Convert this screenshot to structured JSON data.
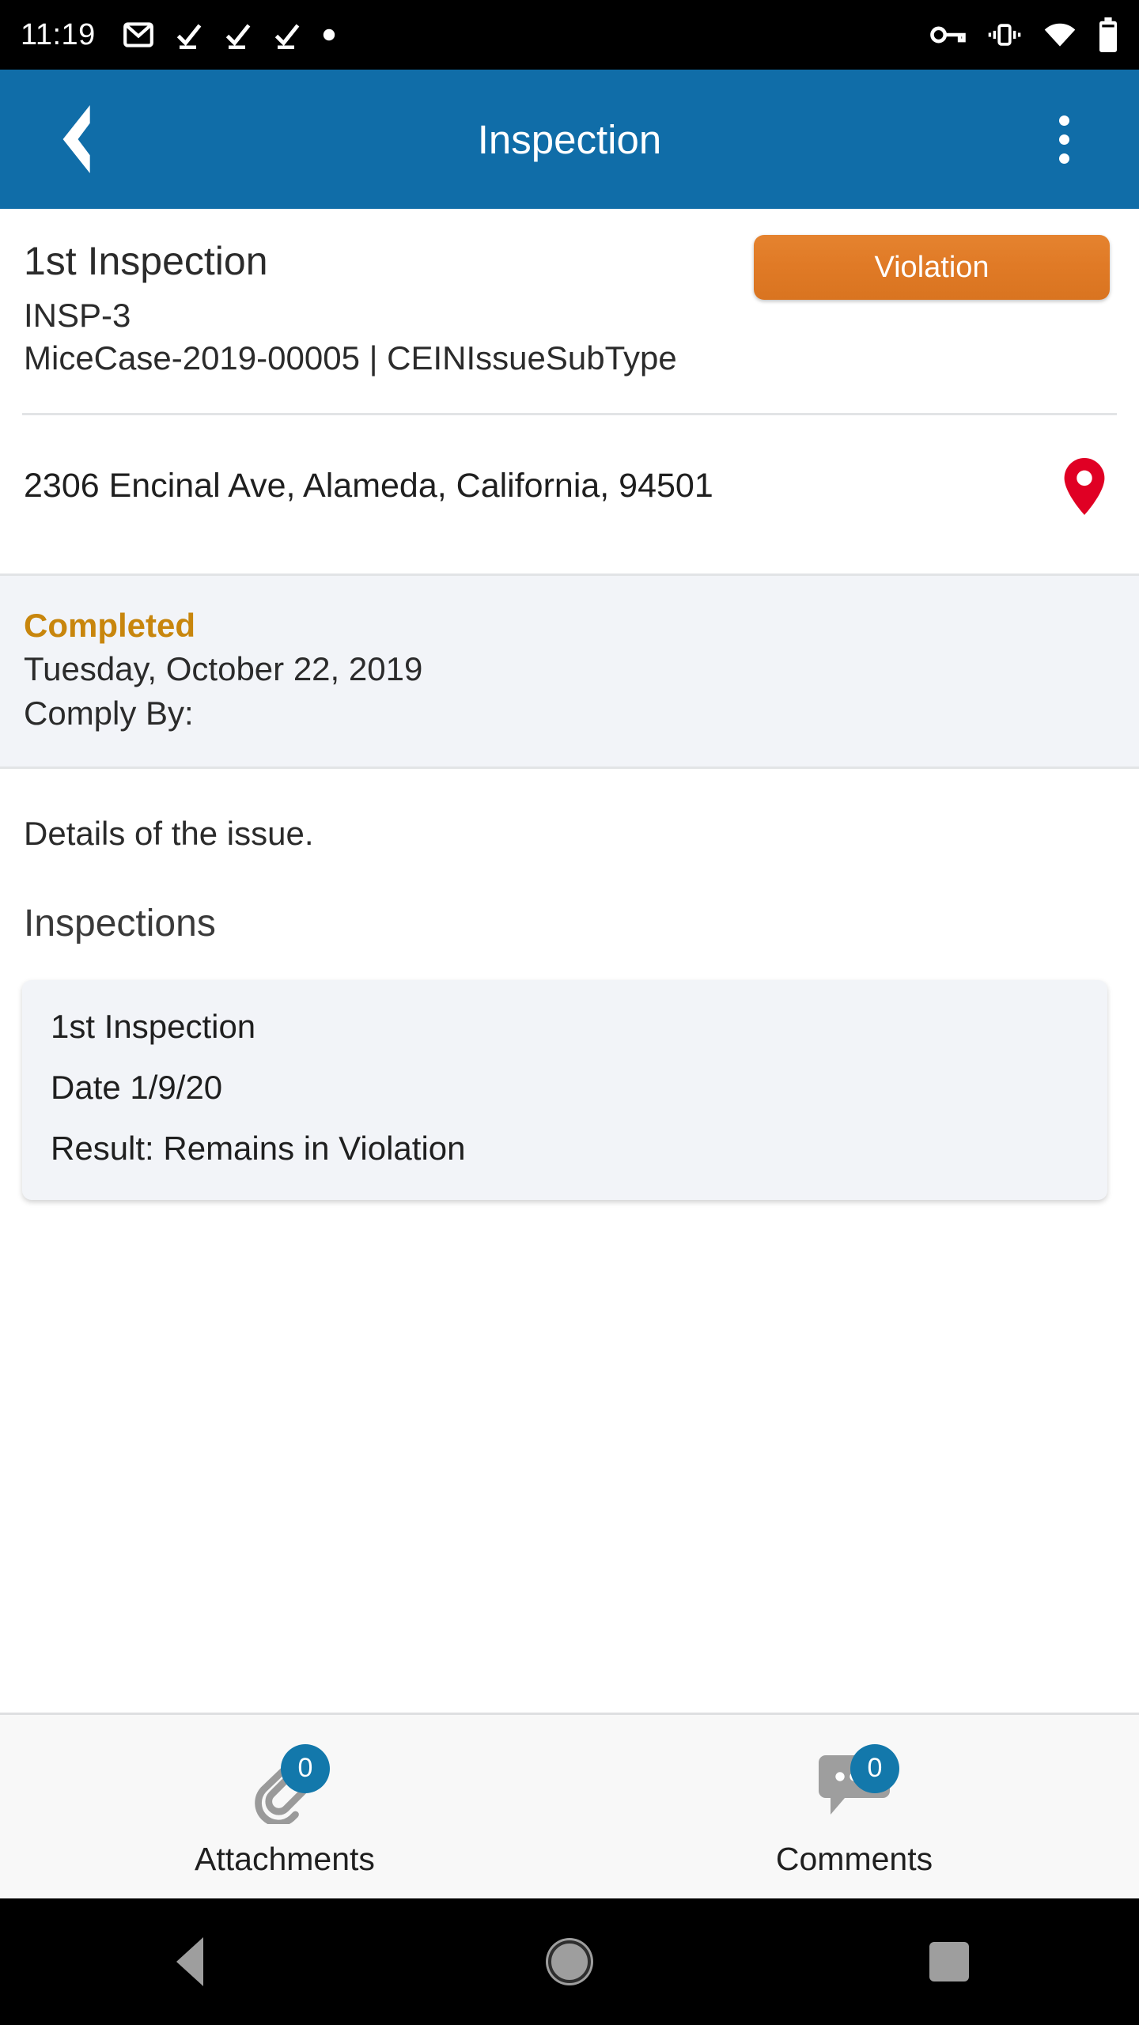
{
  "status_bar": {
    "time": "11:19",
    "left_icons": [
      "gmail-icon",
      "check-icon",
      "check-icon",
      "check-icon",
      "dot-icon"
    ],
    "right_icons": [
      "vpn-key-icon",
      "vibrate-icon",
      "wifi-icon",
      "battery-icon"
    ]
  },
  "app_bar": {
    "back_label": "back-chevron",
    "title": "Inspection",
    "overflow_label": "more-options"
  },
  "record": {
    "title": "1st Inspection",
    "code": "INSP-3",
    "case_line": "MiceCase-2019-00005 | CEINIssueSubType",
    "badge": "Violation",
    "badge_color": "#e07a26",
    "address": "2306 Encinal Ave, Alameda, California, 94501",
    "map_pin_color": "#e00024"
  },
  "status_panel": {
    "state": "Completed",
    "state_color": "#c8860d",
    "date": "Tuesday, October 22, 2019",
    "comply_by": "Comply By:"
  },
  "details": {
    "text": "Details of the issue."
  },
  "inspections_section": {
    "heading": "Inspections",
    "cards": [
      {
        "title": "1st Inspection",
        "date": "Date 1/9/20",
        "result": "Result: Remains in Violation"
      }
    ]
  },
  "bottom_bar": {
    "items": [
      {
        "label": "Attachments",
        "count": "0",
        "icon": "paperclip-icon"
      },
      {
        "label": "Comments",
        "count": "0",
        "icon": "comment-bubble-icon"
      }
    ],
    "badge_color": "#1378ab"
  },
  "nav_bar": {
    "back": "back-triangle",
    "home": "home-circle",
    "recents": "recents-square"
  }
}
